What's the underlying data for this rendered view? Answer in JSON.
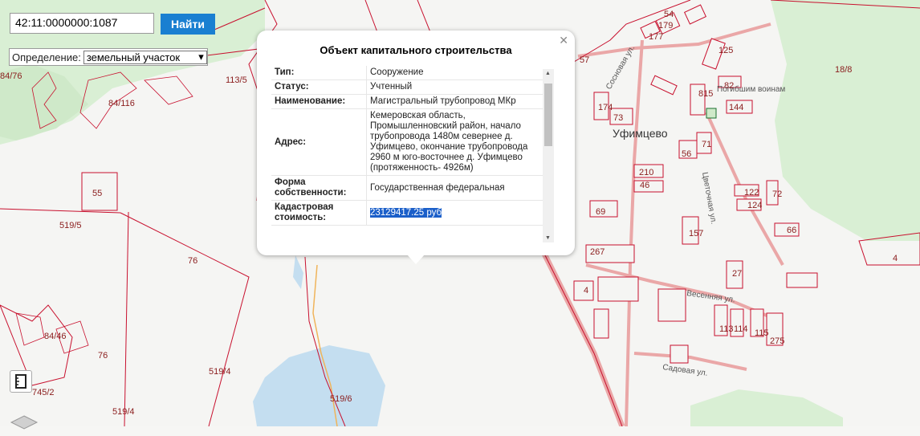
{
  "search": {
    "value": "42:11:0000000:1087",
    "button_label": "Найти"
  },
  "definition": {
    "label": "Определение:",
    "selected": "земельный участок"
  },
  "popup": {
    "title": "Объект капитального строительства",
    "rows": [
      {
        "key": "Тип:",
        "value": "Сооружение"
      },
      {
        "key": "Статус:",
        "value": "Учтенный"
      },
      {
        "key": "Наименование:",
        "value": "Магистральный трубопровод МКр"
      },
      {
        "key": "Адрес:",
        "value": "Кемеровская область, Промышленновский район, начало трубопровода 1480м севернее д. Уфимцево, окончание трубопровода 2960 м юго-восточнее д. Уфимцево (протяженность- 4926м)"
      },
      {
        "key": "Форма собственности:",
        "value": "Государственная федеральная"
      },
      {
        "key": "Кадастровая стоимость:",
        "value": "23129417.25 руб"
      }
    ]
  },
  "map": {
    "town_name": "Уфимцево",
    "parcel_labels": [
      "84/76",
      "113/5",
      "84/116",
      "55",
      "519/5",
      "76",
      "84/46",
      "76",
      "745/2",
      "519/4",
      "519/4",
      "519/6",
      "18/8",
      "4"
    ],
    "house_labels": [
      "54",
      "179",
      "177",
      "125",
      "57",
      "174",
      "73",
      "82",
      "815",
      "144",
      "56",
      "71",
      "210",
      "46",
      "122",
      "72",
      "69",
      "124",
      "157",
      "66",
      "267",
      "27",
      "4",
      "113",
      "114",
      "115",
      "275"
    ],
    "street_labels": [
      "Весенняя ул.",
      "Садовая ул.",
      "Погибшим воинам",
      "Сосновая ул.",
      "Цветочная ул."
    ],
    "colors": {
      "parcel_line": "#c8102e",
      "green_area": "#d9efd4",
      "water": "#c4def0",
      "road": "#eaa7a7",
      "pipeline": "#f0b45a"
    }
  }
}
